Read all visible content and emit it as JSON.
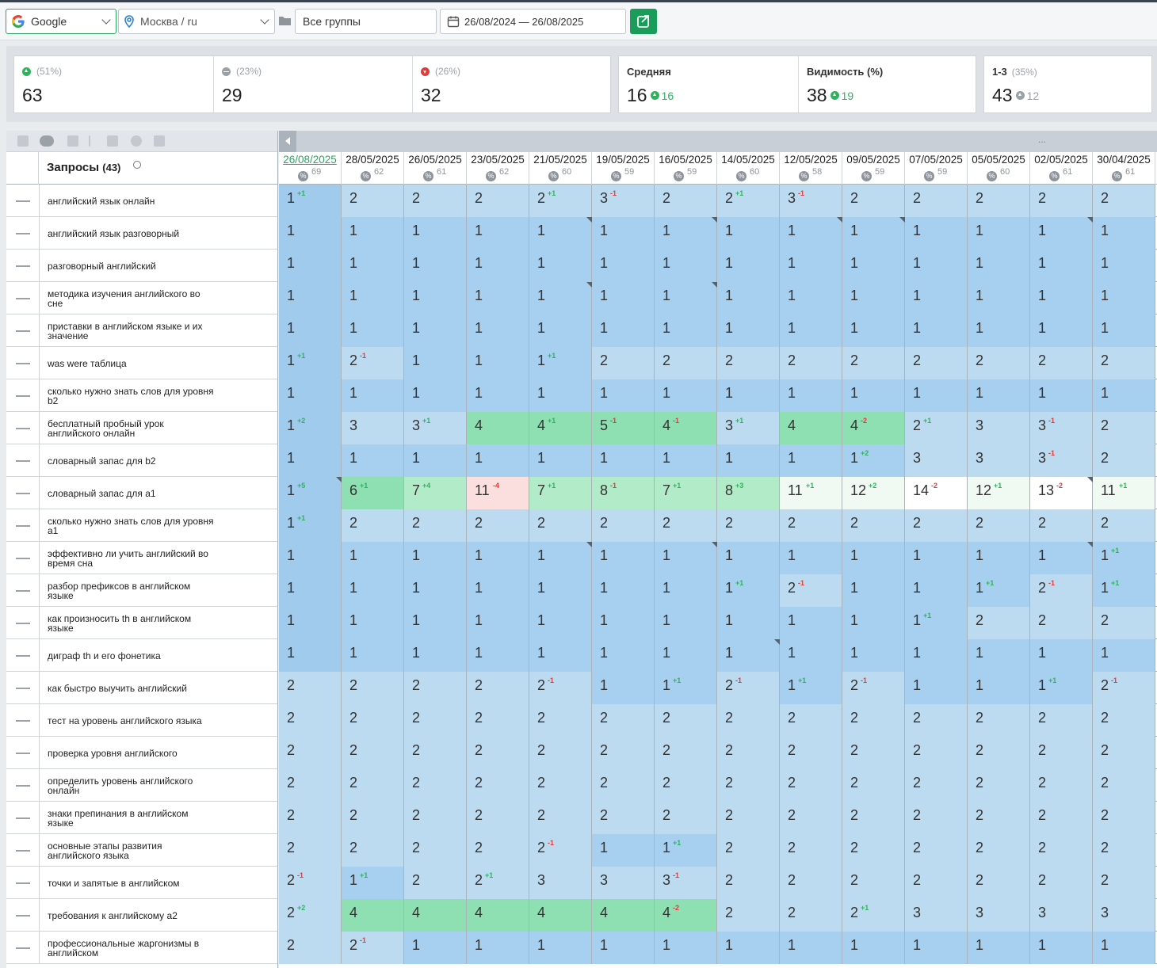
{
  "toolbar": {
    "engine": "Google",
    "region": "Москва / ru",
    "groups": "Все группы",
    "date_range": "26/08/2024 — 26/08/2025"
  },
  "summary": {
    "up": {
      "pct": "(51%)",
      "value": "63"
    },
    "same": {
      "pct": "(23%)",
      "value": "29"
    },
    "down": {
      "pct": "(26%)",
      "value": "32"
    },
    "avg": {
      "label": "Средняя",
      "value": "16",
      "delta": "16"
    },
    "vis": {
      "label": "Видимость (%)",
      "value": "38",
      "delta": "19"
    },
    "top3": {
      "label": "1-3",
      "pct": "(35%)",
      "value": "43",
      "delta": "12"
    }
  },
  "table": {
    "title": "Запросы",
    "count": "(43)",
    "more": "...",
    "dates": [
      {
        "d": "26/08/2025",
        "v": "69"
      },
      {
        "d": "28/05/2025",
        "v": "62"
      },
      {
        "d": "26/05/2025",
        "v": "61"
      },
      {
        "d": "23/05/2025",
        "v": "62"
      },
      {
        "d": "21/05/2025",
        "v": "60"
      },
      {
        "d": "19/05/2025",
        "v": "59"
      },
      {
        "d": "16/05/2025",
        "v": "59"
      },
      {
        "d": "14/05/2025",
        "v": "60"
      },
      {
        "d": "12/05/2025",
        "v": "58"
      },
      {
        "d": "09/05/2025",
        "v": "59"
      },
      {
        "d": "07/05/2025",
        "v": "59"
      },
      {
        "d": "05/05/2025",
        "v": "60"
      },
      {
        "d": "02/05/2025",
        "v": "61"
      },
      {
        "d": "30/04/2025",
        "v": "61"
      }
    ],
    "rows": [
      {
        "q": "английский язык онлайн",
        "cells": [
          "1|+1|1",
          "2||2",
          "2||2",
          "2||2",
          "2|+1|2",
          "3|-1|2",
          "2||2",
          "2|+1|2",
          "3|-1|2",
          "2||2",
          "2||2",
          "2||2",
          "2||2",
          "2||2"
        ]
      },
      {
        "q": "английский язык разговорный",
        "cells": [
          "1||1",
          "1||1",
          "1||1",
          "1||1",
          "1||1|f",
          "1||1",
          "1||1|f",
          "1||1",
          "1||1|f",
          "1||1|f",
          "1||1",
          "1||1",
          "1||1|f",
          "1||1"
        ]
      },
      {
        "q": "разговорный английский",
        "cells": [
          "1||1",
          "1||1",
          "1||1",
          "1||1",
          "1||1",
          "1||1",
          "1||1",
          "1||1",
          "1||1",
          "1||1",
          "1||1",
          "1||1",
          "1||1",
          "1||1"
        ]
      },
      {
        "q": "методика изучения английского во сне",
        "cells": [
          "1||1",
          "1||1",
          "1||1",
          "1||1",
          "1||1|f",
          "1||1",
          "1||1|f",
          "1||1",
          "1||1",
          "1||1",
          "1||1",
          "1||1",
          "1||1",
          "1||1"
        ]
      },
      {
        "q": "приставки в английском языке и их значение",
        "cells": [
          "1||1",
          "1||1",
          "1||1",
          "1||1",
          "1||1",
          "1||1",
          "1||1",
          "1||1",
          "1||1",
          "1||1",
          "1||1",
          "1||1",
          "1||1",
          "1||1"
        ]
      },
      {
        "q": "was were таблица",
        "cells": [
          "1|+1|1",
          "2|-1|2",
          "1||1",
          "1||1",
          "1|+1|1",
          "2||2",
          "2||2",
          "2||2",
          "2||2",
          "2||2",
          "2||2",
          "2||2",
          "2||2",
          "2||2"
        ]
      },
      {
        "q": "сколько нужно знать слов для уровня b2",
        "cells": [
          "1||1",
          "1||1",
          "1||1",
          "1||1",
          "1||1",
          "1||1",
          "1||1",
          "1||1",
          "1||1",
          "1||1",
          "1||1",
          "1||1",
          "1||1",
          "1||1"
        ]
      },
      {
        "q": "бесплатный пробный урок английского онлайн",
        "cells": [
          "1|+2|1",
          "3||2",
          "3|+1|2",
          "4||3",
          "4|+1|3",
          "5|-1|3",
          "4|-1|3",
          "3|+1|2",
          "4||3",
          "4|-2|3",
          "2|+1|2",
          "3||2",
          "3|-1|2",
          "2||2"
        ]
      },
      {
        "q": "словарный запас для b2",
        "cells": [
          "1||1",
          "1||1",
          "1||1",
          "1||1",
          "1||1",
          "1||1",
          "1||1",
          "1||1",
          "1||1",
          "1|+2|1",
          "3||2",
          "3||2",
          "3|-1|2",
          "2||2"
        ]
      },
      {
        "q": "словарный запас для a1",
        "cells": [
          "1|+5|1|f",
          "6|+1|3",
          "7|+4|4",
          "11|-4|7",
          "7|+1|4",
          "8|-1|4",
          "7|+1|4",
          "8|+3|4",
          "11|+1|5",
          "12|+2|5",
          "14|-2|6",
          "12|+1|5",
          "13|-2|6|f",
          "11|+1|5"
        ]
      },
      {
        "q": "сколько нужно знать слов для уровня a1",
        "cells": [
          "1|+1|1",
          "2||2",
          "2||2",
          "2||2",
          "2||2",
          "2||2",
          "2||2",
          "2||2",
          "2||2",
          "2||2",
          "2||2",
          "2||2",
          "2||2",
          "2||2"
        ]
      },
      {
        "q": "эффективно ли учить английский во время сна",
        "cells": [
          "1||1",
          "1||1",
          "1||1",
          "1||1",
          "1||1|f",
          "1||1",
          "1||1|f",
          "1||1",
          "1||1",
          "1||1",
          "1||1",
          "1||1",
          "1||1|f",
          "1|+1|1"
        ]
      },
      {
        "q": "разбор префиксов в английском языке",
        "cells": [
          "1||1",
          "1||1",
          "1||1",
          "1||1",
          "1||1",
          "1||1",
          "1||1",
          "1|+1|1",
          "2|-1|2",
          "1||1",
          "1||1",
          "1|+1|1",
          "2|-1|2",
          "1|+1|1"
        ]
      },
      {
        "q": "как произносить th в английском языке",
        "cells": [
          "1||1",
          "1||1",
          "1||1",
          "1||1",
          "1||1",
          "1||1",
          "1||1",
          "1||1",
          "1||1",
          "1||1",
          "1|+1|1",
          "2||2",
          "2||2",
          "2||2"
        ]
      },
      {
        "q": "диграф th и его фонетика",
        "cells": [
          "1||1",
          "1||1",
          "1||1",
          "1||1",
          "1||1",
          "1||1",
          "1||1",
          "1||1|f",
          "1||1",
          "1||1",
          "1||1",
          "1||1",
          "1||1",
          "1||1"
        ]
      },
      {
        "q": "как быстро выучить английский",
        "cells": [
          "2||2",
          "2||2",
          "2||2",
          "2||2",
          "2|-1|2",
          "1||1",
          "1|+1|1",
          "2|-1|2",
          "1|+1|1",
          "2|-1|2",
          "1||1",
          "1||1",
          "1|+1|1",
          "2|-1|2"
        ]
      },
      {
        "q": "тест на уровень английского языка",
        "cells": [
          "2||2",
          "2||2",
          "2||2",
          "2||2",
          "2||2",
          "2||2",
          "2||2",
          "2||2",
          "2||2",
          "2||2",
          "2||2",
          "2||2",
          "2||2",
          "2||2"
        ]
      },
      {
        "q": "проверка уровня английского",
        "cells": [
          "2||2",
          "2||2",
          "2||2",
          "2||2",
          "2||2",
          "2||2",
          "2||2",
          "2||2",
          "2||2",
          "2||2",
          "2||2",
          "2||2",
          "2||2",
          "2||2"
        ]
      },
      {
        "q": "определить уровень английского онлайн",
        "cells": [
          "2||2",
          "2||2",
          "2||2",
          "2||2",
          "2||2",
          "2||2",
          "2||2",
          "2||2",
          "2||2",
          "2||2",
          "2||2",
          "2||2",
          "2||2",
          "2||2"
        ]
      },
      {
        "q": "знаки препинания в английском языке",
        "cells": [
          "2||2",
          "2||2",
          "2||2",
          "2||2",
          "2||2",
          "2||2",
          "2||2",
          "2||2",
          "2||2",
          "2||2",
          "2||2",
          "2||2",
          "2||2",
          "2||2"
        ]
      },
      {
        "q": "основные этапы развития английского языка",
        "cells": [
          "2||2",
          "2||2",
          "2||2",
          "2||2",
          "2|-1|2",
          "1||1",
          "1|+1|1",
          "2||2",
          "2||2",
          "2||2",
          "2||2",
          "2||2",
          "2||2",
          "2||2"
        ]
      },
      {
        "q": "точки и запятые в английском",
        "cells": [
          "2|-1|2",
          "1|+1|1",
          "2||2",
          "2|+1|2",
          "3||2",
          "3||2",
          "3|-1|2",
          "2||2",
          "2||2",
          "2||2",
          "2||2",
          "2||2",
          "2||2",
          "2||2"
        ]
      },
      {
        "q": "требования к английскому a2",
        "cells": [
          "2|+2|2",
          "4||3",
          "4||3",
          "4||3",
          "4||3",
          "4||3",
          "4|-2|3",
          "2||2",
          "2||2",
          "2|+1|2",
          "3||2",
          "3||2",
          "3||2",
          "3||2"
        ]
      },
      {
        "q": "профессиональные жаргонизмы в английском",
        "cells": [
          "2||2",
          "2|-1|2",
          "1||1",
          "1||1",
          "1||1",
          "1||1",
          "1||1",
          "1||1",
          "1||1",
          "1||1",
          "1||1",
          "1||1",
          "1||1",
          "1||1"
        ]
      }
    ]
  },
  "colors": {
    "accent": "#1a9c5b",
    "up": "#2eb35d",
    "down": "#e03b3b"
  }
}
